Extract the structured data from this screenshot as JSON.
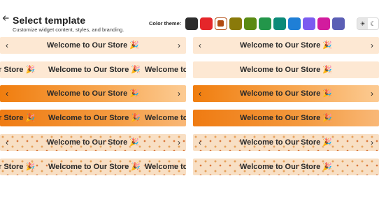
{
  "header": {
    "title": "Select template",
    "subtitle": "Customize widget content, styles, and branding.",
    "color_theme_label": "Color theme:"
  },
  "colors": {
    "swatches": [
      "#2d2d2d",
      "#e5262a",
      "#b14a10",
      "#8a7a0a",
      "#5a8a12",
      "#23964a",
      "#0b8a78",
      "#1f7fd6",
      "#7b5cf0",
      "#d21c9e",
      "#5b5fb5"
    ],
    "selected_swatch": "#b14a10"
  },
  "mode_toggle": {
    "light_icon": "sun-icon",
    "dark_icon": "moon-icon",
    "active": "light"
  },
  "banner": {
    "text": "Welcome to Our Store 🎉",
    "scroll_fragment_start": "r Store 🎉",
    "scroll_fragment_end": "Welcome to",
    "left_arrow": "‹",
    "right_arrow": "›"
  }
}
